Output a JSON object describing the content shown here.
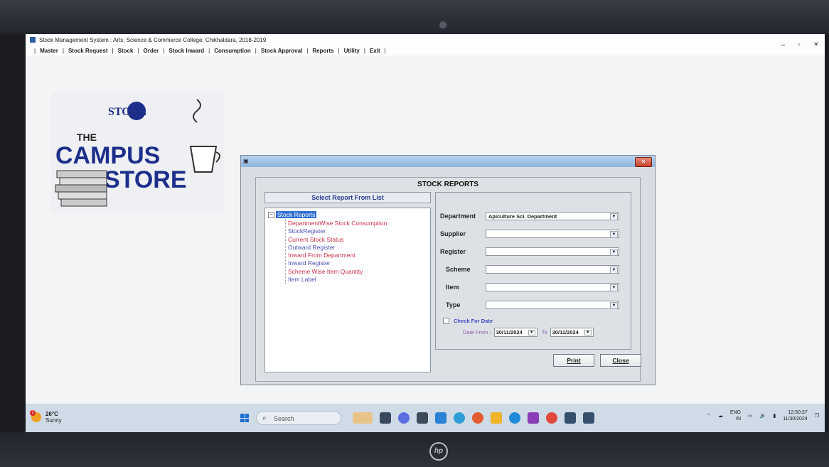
{
  "window": {
    "title": "Stock Management System : Arts, Science & Commerce College, Chikhaldara, 2018-2019",
    "minimize": "–",
    "maximize": "▫",
    "close": "✕"
  },
  "menu": [
    "Master",
    "Stock Request",
    "Stock",
    "Order",
    "Stock Inward",
    "Consumption",
    "Stock Approval",
    "Reports",
    "Utility",
    "Exit"
  ],
  "logo": {
    "top": "STORE",
    "line1": "THE",
    "line2": "CAMPUS",
    "line3": "STORE"
  },
  "dialog": {
    "heading": "STOCK REPORTS",
    "close_label": "✕",
    "list_heading": "Select Report From List",
    "tree_root": "Stock Reports",
    "tree_items": [
      {
        "label": "DepartmentWise Stock Consumption",
        "color": "#c8304a"
      },
      {
        "label": "StockRegister",
        "color": "#4a4fb8"
      },
      {
        "label": "Current Stock Status",
        "color": "#c8304a"
      },
      {
        "label": "Outward Register",
        "color": "#4a4fb8"
      },
      {
        "label": "Inward From Department",
        "color": "#c8304a"
      },
      {
        "label": "Inward Register",
        "color": "#4a4fb8"
      },
      {
        "label": "Scheme Wise Item Quantity",
        "color": "#c8304a"
      },
      {
        "label": "Item Label",
        "color": "#4a4fb8"
      }
    ],
    "fields": {
      "department": {
        "label": "Department",
        "value": "Apiculture Sci. Department"
      },
      "supplier": {
        "label": "Supplier",
        "value": ""
      },
      "register": {
        "label": "Register",
        "value": ""
      },
      "scheme": {
        "label": "Scheme",
        "value": ""
      },
      "item": {
        "label": "Item",
        "value": ""
      },
      "type": {
        "label": "Type",
        "value": ""
      }
    },
    "check_for_date": "Check For Date",
    "date_from_label": "Date From :",
    "date_from": "30/11/2024",
    "to_label": "To",
    "date_to": "30/11/2024",
    "print_button": "Print",
    "close_button": "Close"
  },
  "taskbar": {
    "temperature": "26°C",
    "weather": "Sunny",
    "weather_badge": "1",
    "search_placeholder": "Search",
    "lang1": "ENG",
    "lang2": "IN",
    "time": "12:50:37",
    "date": "11/30/2024"
  },
  "brand": "hp"
}
